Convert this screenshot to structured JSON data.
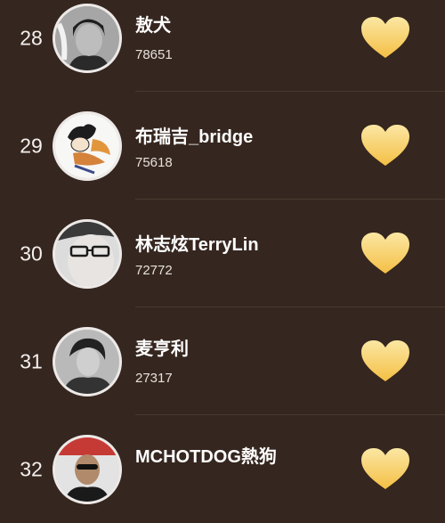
{
  "list": {
    "items": [
      {
        "rank": "28",
        "name": "敖犬",
        "votes": "78651",
        "avatar_icon": "avatar-photo-icon",
        "like_icon": "heart-icon"
      },
      {
        "rank": "29",
        "name": "布瑞吉_bridge",
        "votes": "75618",
        "avatar_icon": "avatar-illustration-icon",
        "like_icon": "heart-icon"
      },
      {
        "rank": "30",
        "name": "林志炫TerryLin",
        "votes": "72772",
        "avatar_icon": "avatar-photo-icon",
        "like_icon": "heart-icon"
      },
      {
        "rank": "31",
        "name": "麦亨利",
        "votes": "27317",
        "avatar_icon": "avatar-photo-icon",
        "like_icon": "heart-icon"
      },
      {
        "rank": "32",
        "name": "MCHOTDOG熱狗",
        "votes": "",
        "avatar_icon": "avatar-photo-icon",
        "like_icon": "heart-icon"
      }
    ]
  },
  "colors": {
    "background": "#35261f",
    "heart_top": "#fbe7a3",
    "heart_bottom": "#f4bf45",
    "avatar_ring": "#ece9e7"
  }
}
